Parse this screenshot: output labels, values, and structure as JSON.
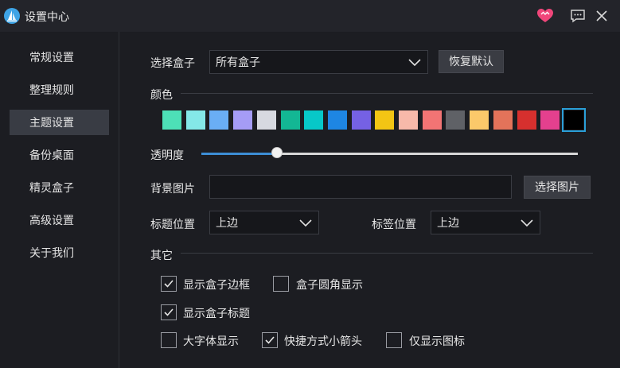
{
  "window": {
    "title": "设置中心"
  },
  "sidebar": {
    "items": [
      {
        "label": "常规设置",
        "active": false
      },
      {
        "label": "整理规则",
        "active": false
      },
      {
        "label": "主题设置",
        "active": true
      },
      {
        "label": "备份桌面",
        "active": false
      },
      {
        "label": "精灵盒子",
        "active": false
      },
      {
        "label": "高级设置",
        "active": false
      },
      {
        "label": "关于我们",
        "active": false
      }
    ]
  },
  "theme": {
    "box_select_label": "选择盒子",
    "box_select_value": "所有盒子",
    "restore_default_label": "恢复默认",
    "color_section_label": "颜色",
    "colors": [
      "#4de0b7",
      "#84e8e8",
      "#6aaef5",
      "#a59cf6",
      "#d7d9e0",
      "#13b794",
      "#07c8c8",
      "#1e86e3",
      "#7561e4",
      "#f3c514",
      "#f7b9aa",
      "#f27474",
      "#5f6166",
      "#fbc96a",
      "#e3735a",
      "#d6302e",
      "#e4408e",
      "#000000"
    ],
    "selected_color_index": 17,
    "opacity_label": "透明度",
    "opacity_value": 0.2,
    "bg_image_label": "背景图片",
    "bg_image_value": "",
    "choose_image_label": "选择图片",
    "title_position_label": "标题位置",
    "title_position_value": "上边",
    "tag_position_label": "标签位置",
    "tag_position_value": "上边",
    "other_section_label": "其它",
    "options": [
      {
        "label": "显示盒子边框",
        "checked": true
      },
      {
        "label": "盒子圆角显示",
        "checked": false
      },
      {
        "label": "显示盒子标题",
        "checked": true
      },
      {
        "label": "大字体显示",
        "checked": false
      },
      {
        "label": "快捷方式小箭头",
        "checked": true
      },
      {
        "label": "仅显示图标",
        "checked": false
      }
    ]
  },
  "icons": {
    "logo": "sailboat-logo-icon",
    "heart": "heart-icon",
    "feedback": "feedback-icon",
    "close": "close-icon",
    "chevron": "chevron-down-icon",
    "check": "checkmark-icon"
  },
  "accent_colors": {
    "heart": "#f0467a",
    "active_nav": "#393c44",
    "slider_fill": "#3d8ed6",
    "selected_outline": "#2a9fd8"
  }
}
